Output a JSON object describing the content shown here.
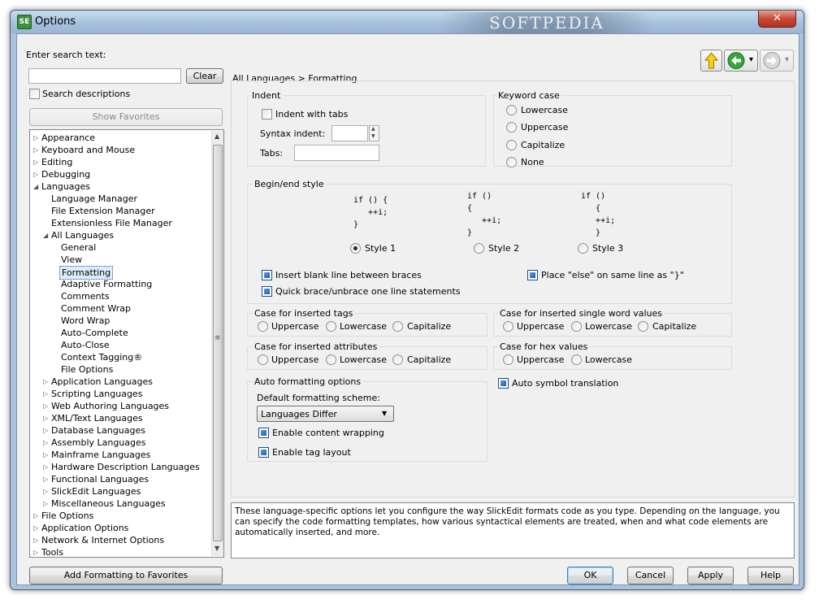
{
  "window": {
    "title": "Options",
    "app_icon_text": "SE",
    "close_glyph": "✕",
    "watermark": "SOFTPEDIA"
  },
  "search": {
    "label": "Enter search text:",
    "value": "",
    "clear_button": "Clear",
    "search_descriptions": "Search descriptions",
    "search_descriptions_checked": false,
    "show_favorites": "Show Favorites"
  },
  "nav": {
    "up_icon": "up-arrow-icon",
    "back_icon": "back-arrow-icon",
    "forward_icon": "forward-arrow-icon",
    "dropdown_glyph": "▾"
  },
  "tree": {
    "items": [
      {
        "label": "Appearance",
        "expander": "▷"
      },
      {
        "label": "Keyboard and Mouse",
        "expander": "▷"
      },
      {
        "label": "Editing",
        "expander": "▷"
      },
      {
        "label": "Debugging",
        "expander": "▷"
      },
      {
        "label": "Languages",
        "expander": "◢"
      },
      {
        "label": "Language Manager",
        "expander": ""
      },
      {
        "label": "File Extension Manager",
        "expander": ""
      },
      {
        "label": "Extensionless File Manager",
        "expander": ""
      },
      {
        "label": "All Languages",
        "expander": "◢"
      },
      {
        "label": "General",
        "expander": ""
      },
      {
        "label": "View",
        "expander": ""
      },
      {
        "label": "Formatting",
        "expander": "",
        "selected": true
      },
      {
        "label": "Adaptive Formatting",
        "expander": ""
      },
      {
        "label": "Comments",
        "expander": ""
      },
      {
        "label": "Comment Wrap",
        "expander": ""
      },
      {
        "label": "Word Wrap",
        "expander": ""
      },
      {
        "label": "Auto-Complete",
        "expander": ""
      },
      {
        "label": "Auto-Close",
        "expander": ""
      },
      {
        "label": "Context Tagging®",
        "expander": ""
      },
      {
        "label": "File Options",
        "expander": ""
      },
      {
        "label": "Application Languages",
        "expander": "▷"
      },
      {
        "label": "Scripting Languages",
        "expander": "▷"
      },
      {
        "label": "Web Authoring Languages",
        "expander": "▷"
      },
      {
        "label": "XML/Text Languages",
        "expander": "▷"
      },
      {
        "label": "Database Languages",
        "expander": "▷"
      },
      {
        "label": "Assembly Languages",
        "expander": "▷"
      },
      {
        "label": "Mainframe Languages",
        "expander": "▷"
      },
      {
        "label": "Hardware Description Languages",
        "expander": "▷"
      },
      {
        "label": "Functional Languages",
        "expander": "▷"
      },
      {
        "label": "SlickEdit Languages",
        "expander": "▷"
      },
      {
        "label": "Miscellaneous Languages",
        "expander": "▷"
      },
      {
        "label": "File Options",
        "expander": "▷"
      },
      {
        "label": "Application Options",
        "expander": "▷"
      },
      {
        "label": "Network & Internet Options",
        "expander": "▷"
      },
      {
        "label": "Tools",
        "expander": "▷"
      }
    ],
    "scroll_up": "▲",
    "scroll_down": "▼",
    "grip": "≡"
  },
  "add_favorites": "Add Formatting to Favorites",
  "breadcrumb": "All Languages > Formatting",
  "indent": {
    "title": "Indent",
    "indent_with_tabs": "Indent with tabs",
    "indent_with_tabs_checked": false,
    "syntax_indent_label": "Syntax indent:",
    "syntax_indent_value": "",
    "tabs_label": "Tabs:",
    "tabs_value": ""
  },
  "keyword_case": {
    "title": "Keyword case",
    "options": [
      "Lowercase",
      "Uppercase",
      "Capitalize",
      "None"
    ],
    "selected": -1
  },
  "begin_end": {
    "title": "Begin/end style",
    "style1_code": "if () {\n   ++i;\n}",
    "style2_code": "if ()\n{\n   ++i;\n}",
    "style3_code": "if ()\n   {\n   ++i;\n   }",
    "styles": [
      "Style 1",
      "Style 2",
      "Style 3"
    ],
    "selected": 0,
    "insert_blank_line": "Insert blank line between braces",
    "insert_blank_line_checked": true,
    "else_same_line": "Place \"else\" on same line as \"}\"",
    "else_same_line_checked": true,
    "quick_brace": "Quick brace/unbrace one line statements",
    "quick_brace_checked": true
  },
  "tag_case": {
    "title": "Case for inserted tags",
    "options": [
      "Uppercase",
      "Lowercase",
      "Capitalize"
    ]
  },
  "word_case": {
    "title": "Case for inserted single word values",
    "options": [
      "Uppercase",
      "Lowercase",
      "Capitalize"
    ]
  },
  "attr_case": {
    "title": "Case for inserted attributes",
    "options": [
      "Uppercase",
      "Lowercase",
      "Capitalize"
    ]
  },
  "hex_case": {
    "title": "Case for hex values",
    "options": [
      "Uppercase",
      "Lowercase"
    ]
  },
  "auto_format": {
    "title": "Auto formatting options",
    "scheme_label": "Default formatting scheme:",
    "scheme_value": "Languages Differ",
    "combo_arrow": "▼",
    "content_wrapping": "Enable content wrapping",
    "content_wrapping_checked": true,
    "tag_layout": "Enable tag layout",
    "tag_layout_checked": true
  },
  "auto_symbol": {
    "label": "Auto symbol translation",
    "checked": true
  },
  "description": "These language-specific options let you configure the way SlickEdit formats code as you type. Depending on the language, you can specify the code formatting templates, how various syntactical elements are treated, when and what code elements are automatically inserted, and more.",
  "buttons": {
    "ok": "OK",
    "cancel": "Cancel",
    "apply": "Apply",
    "help": "Help"
  },
  "colors": {
    "accent": "#1f5ea8",
    "selection": "#dcecfc",
    "dialog_bg": "#f0f0f0",
    "frame": "#a9c3dc"
  }
}
